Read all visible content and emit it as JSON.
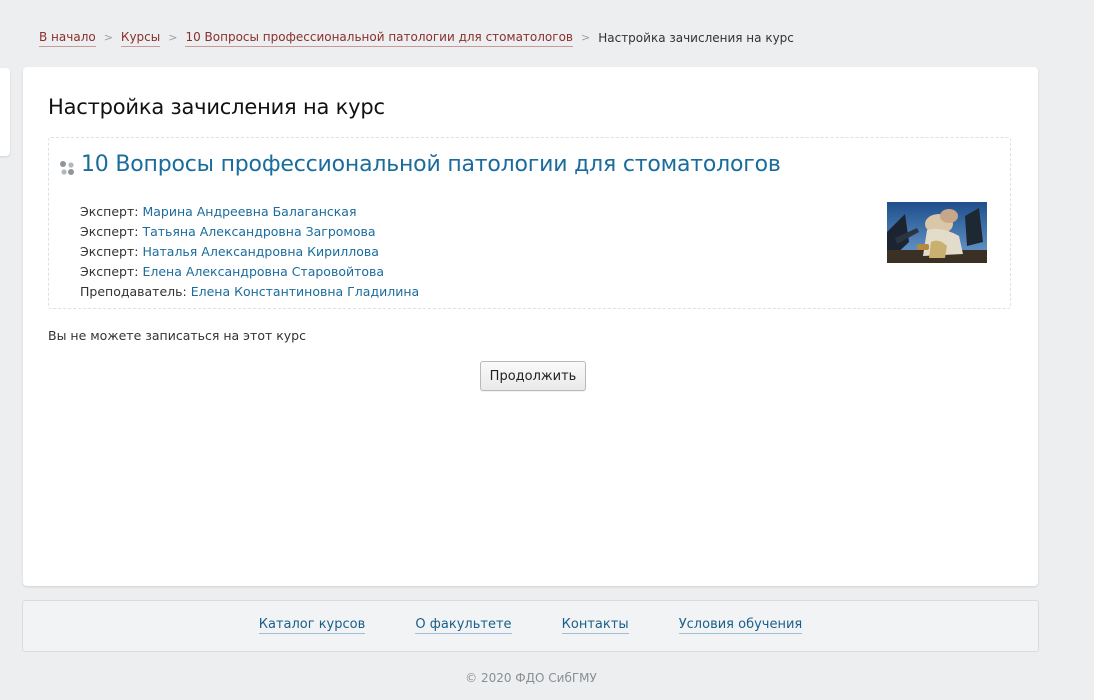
{
  "breadcrumb": {
    "items": [
      {
        "label": "В начало"
      },
      {
        "label": "Курсы"
      },
      {
        "label": "10 Вопросы профессиональной патологии для стоматологов"
      }
    ],
    "separator": ">",
    "current": "Настройка зачисления на курс"
  },
  "page": {
    "title": "Настройка зачисления на курс"
  },
  "course": {
    "title": "10 Вопросы профессиональной патологии для стоматологов",
    "icon": "course-dots-icon",
    "contacts": [
      {
        "role": "Эксперт:",
        "name": "Марина Андреевна Балаганская"
      },
      {
        "role": "Эксперт:",
        "name": "Татьяна Александровна Загромова"
      },
      {
        "role": "Эксперт:",
        "name": "Наталья Александровна Кириллова"
      },
      {
        "role": "Эксперт:",
        "name": "Елена Александровна Старовойтова"
      },
      {
        "role": "Преподаватель:",
        "name": "Елена Константиновна Гладилина"
      }
    ]
  },
  "enrolment": {
    "notice": "Вы не можете записаться на этот курс",
    "continue_label": "Продолжить"
  },
  "footer": {
    "links": [
      {
        "label": "Каталог курсов"
      },
      {
        "label": "О факультете"
      },
      {
        "label": "Контакты"
      },
      {
        "label": "Условия обучения"
      }
    ],
    "copyright": "© 2020 ФДО СибГМУ"
  },
  "colors": {
    "background": "#eceeef",
    "link_blue": "#1a6c9c",
    "breadcrumb_link": "#8b2f2f"
  }
}
